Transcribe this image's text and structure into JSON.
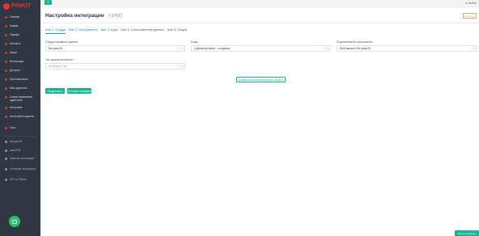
{
  "brand": {
    "name": "PINKIT"
  },
  "sidebar": {
    "items": [
      {
        "label": "Главная",
        "icon": "home-icon"
      },
      {
        "label": "Заявки",
        "icon": "inbox-icon"
      },
      {
        "label": "Тарифы",
        "icon": "tag-icon"
      },
      {
        "label": "Контакты",
        "icon": "users-icon"
      },
      {
        "label": "Акции",
        "icon": "gift-icon"
      },
      {
        "label": "Интеграции",
        "icon": "plug-icon"
      },
      {
        "label": "Доступы",
        "icon": "key-icon"
      },
      {
        "label": "Приглашенные",
        "icon": "user-plus-icon"
      },
      {
        "label": "Мои адресаты",
        "icon": "address-book-icon"
      },
      {
        "label": "Схема связывания адресатов",
        "icon": "sitemap-icon"
      },
      {
        "label": "Настройки",
        "icon": "gear-icon"
      },
      {
        "label": "Настройки подписки",
        "icon": "sliders-icon"
      },
      {
        "label": "Чаты",
        "icon": "chat-icon"
      }
    ],
    "secondary": [
      {
        "label": "Битрикс24",
        "icon": "cube-icon"
      },
      {
        "label": "amoCRM",
        "icon": "crm-icon"
      },
      {
        "label": "Магазин интеграций",
        "icon": "store-icon"
      },
      {
        "label": "Полезные материалы",
        "icon": "book-icon"
      },
      {
        "label": "API по Пинкит",
        "icon": "code-icon"
      }
    ]
  },
  "topbar": {
    "menu_icon": "≡",
    "logout_label": "⊖ Выйти"
  },
  "page": {
    "title": "Настройка интеграции",
    "id": "#1485",
    "header_button": "Удалить"
  },
  "tabs": [
    {
      "label": "Шаг 1: Откуда",
      "state": "active"
    },
    {
      "label": "Шаг 2: Инструменты",
      "state": "link"
    },
    {
      "label": "Шаг 3: Куда",
      "state": "link"
    },
    {
      "label": "Шаг 4: Сопоставление данных",
      "state": "plain"
    },
    {
      "label": "Шаг 5: Запуск",
      "state": "plain"
    }
  ],
  "form": {
    "source": {
      "label": "Откуда отправлять данные",
      "value": "Битрикс24"
    },
    "event": {
      "label": "Когда",
      "value": "Сделка/процесс - создание"
    },
    "account": {
      "label": "Подключенный к приложению",
      "value": "Мой аккаунт Битрикс24"
    },
    "entity_type": {
      "label": "Тип сущности/события *",
      "placeholder": "Выберите тип"
    }
  },
  "buttons": {
    "add_field": "Добавить пользовательский фильтр",
    "continue": "Продолжить",
    "test": "Тестовая проверка"
  },
  "help_tab": "Частые вопросы",
  "colors": {
    "accent": "#1ab394",
    "brand": "#e0313b",
    "sidebar": "#2f3742",
    "link": "#2f7bbf"
  }
}
